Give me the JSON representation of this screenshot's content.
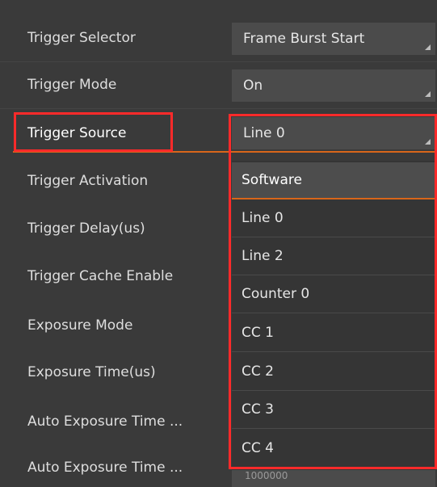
{
  "rows": [
    {
      "label": "Trigger Selector"
    },
    {
      "label": "Trigger Mode"
    },
    {
      "label": "Trigger Source"
    },
    {
      "label": "Trigger Activation"
    },
    {
      "label": "Trigger Delay(us)"
    },
    {
      "label": "Trigger Cache Enable"
    },
    {
      "label": "Exposure Mode"
    },
    {
      "label": "Exposure Time(us)"
    },
    {
      "label": "Auto Exposure Time ..."
    },
    {
      "label": "Auto Exposure Time ..."
    }
  ],
  "fields": {
    "trigger_selector": "Frame Burst Start",
    "trigger_mode": "On",
    "trigger_source": "Line 0",
    "partially_hidden_value": "1000000"
  },
  "dropdown": {
    "options": [
      "Software",
      "Line 0",
      "Line 2",
      "Counter 0",
      "CC 1",
      "CC 2",
      "CC 3",
      "CC 4"
    ],
    "selected": "Software"
  },
  "colors": {
    "background": "#3a3a3a",
    "field": "#4b4b4b",
    "accent_orange": "#d8661a",
    "highlight_red": "#ff2a2a"
  },
  "icons": {
    "resize_grip": "resize-grip-icon"
  }
}
